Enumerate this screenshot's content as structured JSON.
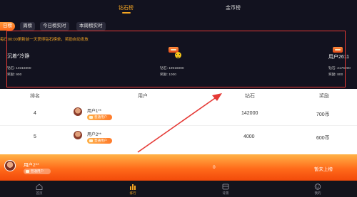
{
  "main_tabs": [
    {
      "label": "钻石榜",
      "active": true
    },
    {
      "label": "金币榜",
      "active": false
    }
  ],
  "period_tabs": [
    {
      "label": "日榜",
      "active": true
    },
    {
      "label": "周榜",
      "active": false
    },
    {
      "label": "今日榜实时",
      "active": false
    },
    {
      "label": "本周榜实时",
      "active": false
    }
  ],
  "notice": "每日00:00更新前一天获得钻石榜单，奖励自动发放",
  "top_users": [
    {
      "name": "沉着^冷静",
      "diamond_label": "钻石: 10316000",
      "reward_label": "奖励: 900"
    },
    {
      "name": "",
      "diamond_label": "钻石: 19016000",
      "reward_label": "奖励: 1000"
    },
    {
      "name": "用户2611",
      "diamond_label": "钻石: 2176000",
      "reward_label": "奖励: 800"
    }
  ],
  "table_headers": {
    "rank": "排名",
    "user": "用户",
    "diamond": "钻石",
    "reward": "奖励"
  },
  "rows": [
    {
      "rank": "4",
      "name": "用户1**",
      "badge": "普通用户",
      "diamond": "142000",
      "reward": "700币"
    },
    {
      "rank": "5",
      "name": "用户2**",
      "badge": "普通用户",
      "diamond": "4000",
      "reward": "600币"
    }
  ],
  "my_rank": {
    "name": "用户2**",
    "badge": "普通用户",
    "score": "0",
    "status": "暂未上榜"
  },
  "bottom_nav": [
    {
      "label": "首页",
      "icon": "home-icon",
      "active": false
    },
    {
      "label": "排行",
      "icon": "ranking-icon",
      "active": true
    },
    {
      "label": "背景",
      "icon": "background-icon",
      "active": false
    },
    {
      "label": "我的",
      "icon": "profile-icon",
      "active": false
    }
  ],
  "colors": {
    "accent": "#f5a623",
    "dark_bg": "#12121f",
    "highlight_border": "#e53935",
    "orange_bar": "#ff6a1a"
  }
}
